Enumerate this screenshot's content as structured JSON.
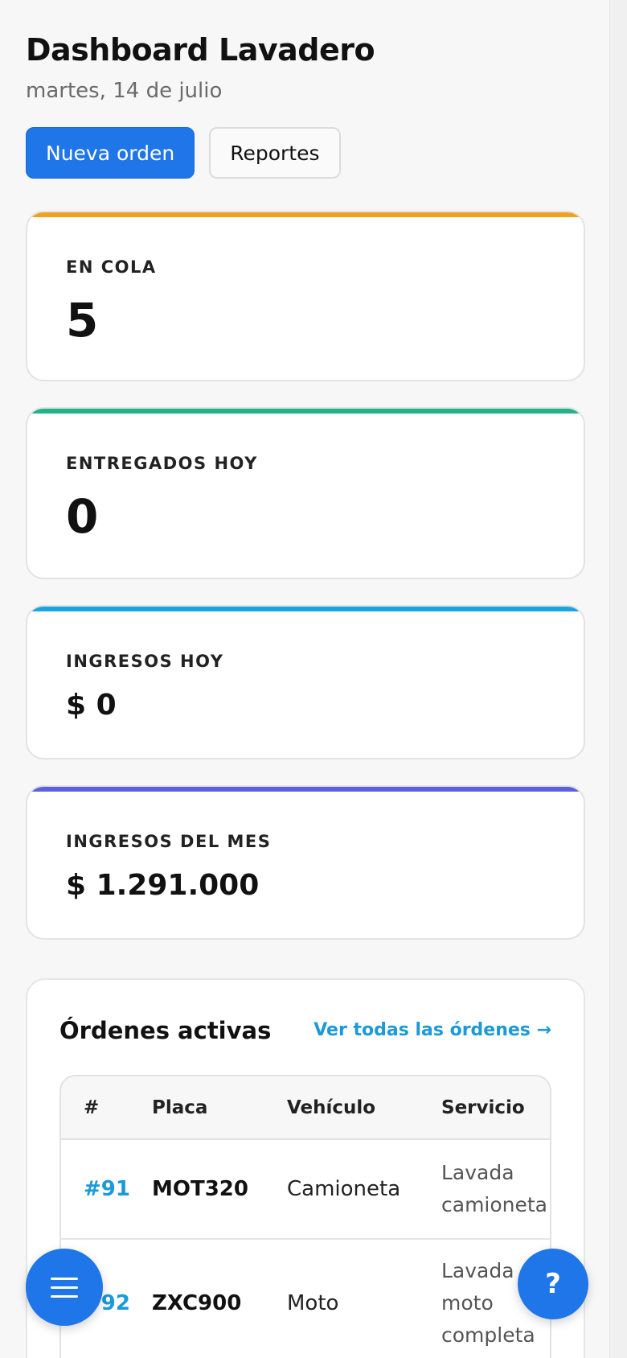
{
  "header": {
    "title": "Dashboard Lavadero",
    "date": "martes, 14 de julio"
  },
  "actions": {
    "new_order": "Nueva orden",
    "reports": "Reportes"
  },
  "stats": [
    {
      "label": "EN COLA",
      "value": "5",
      "accent": "#f0a21e"
    },
    {
      "label": "ENTREGADOS HOY",
      "value": "0",
      "accent": "#1fb385"
    },
    {
      "label": "INGRESOS HOY",
      "value": "$ 0",
      "accent": "#1aa5e0"
    },
    {
      "label": "INGRESOS DEL MES",
      "value": "$ 1.291.000",
      "accent": "#5b5fe0"
    }
  ],
  "orders": {
    "title": "Órdenes activas",
    "view_all": "Ver todas las órdenes →",
    "columns": [
      "#",
      "Placa",
      "Vehículo",
      "Servicio"
    ],
    "rows": [
      {
        "num": "#91",
        "placa": "MOT320",
        "vehiculo": "Camioneta",
        "servicio": "Lavada camioneta"
      },
      {
        "num": "#92",
        "placa": "ZXC900",
        "vehiculo": "Moto",
        "servicio": "Lavada moto completa"
      }
    ]
  },
  "fab": {
    "menu_icon": "menu-icon",
    "help_label": "?"
  },
  "colors": {
    "primary": "#1f76e8",
    "link": "#1a9ad8"
  }
}
